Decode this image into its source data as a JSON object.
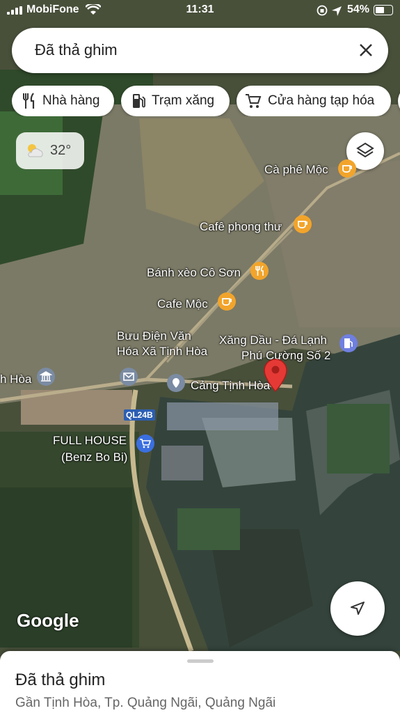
{
  "status_bar": {
    "carrier": "MobiFone",
    "time": "11:31",
    "battery": "54%"
  },
  "search": {
    "value": "Đã thả ghim"
  },
  "chips": [
    {
      "label": "Nhà hàng",
      "icon": "restaurant-icon"
    },
    {
      "label": "Trạm xăng",
      "icon": "gas-station-icon"
    },
    {
      "label": "Cửa hàng tạp hóa",
      "icon": "cart-icon"
    }
  ],
  "weather": {
    "temp": "32°",
    "icon": "partly-cloudy-icon"
  },
  "map_labels": {
    "ca_phe_moc": "Cà phê Mộc",
    "cafe_phong_thu": "Cafê phong thư",
    "banh_xeo": "Bánh xèo Cô Sơn",
    "cafe_moc": "Cafe Mộc",
    "buu_dien_line1": "Bưu Điện Văn",
    "buu_dien_line2": "Hóa Xã Tịnh Hòa",
    "xang_dau_line1": "Xăng Dầu - Đá Lạnh",
    "xang_dau_line2": "Phú Cường Số 2",
    "cang": "Cảng Tịnh Hòa",
    "tinh_hoa_partial": "h Hòa",
    "full_house_line1": "FULL HOUSE",
    "full_house_line2": "(Benz Bo Bi)",
    "road": "QL24B"
  },
  "colors": {
    "coffee_pin": "#f2a42b",
    "post_pin": "#7a8ba3",
    "gas_pin": "#6f7fe0",
    "shop_pin": "#3b6fe0",
    "red_pin": "#e53935",
    "road_badge": "#2c5fb3"
  },
  "attribution": "Google",
  "bottom_sheet": {
    "title": "Đã thả ghim",
    "address": "Gần Tịnh Hòa, Tp. Quảng Ngãi, Quảng Ngãi"
  }
}
